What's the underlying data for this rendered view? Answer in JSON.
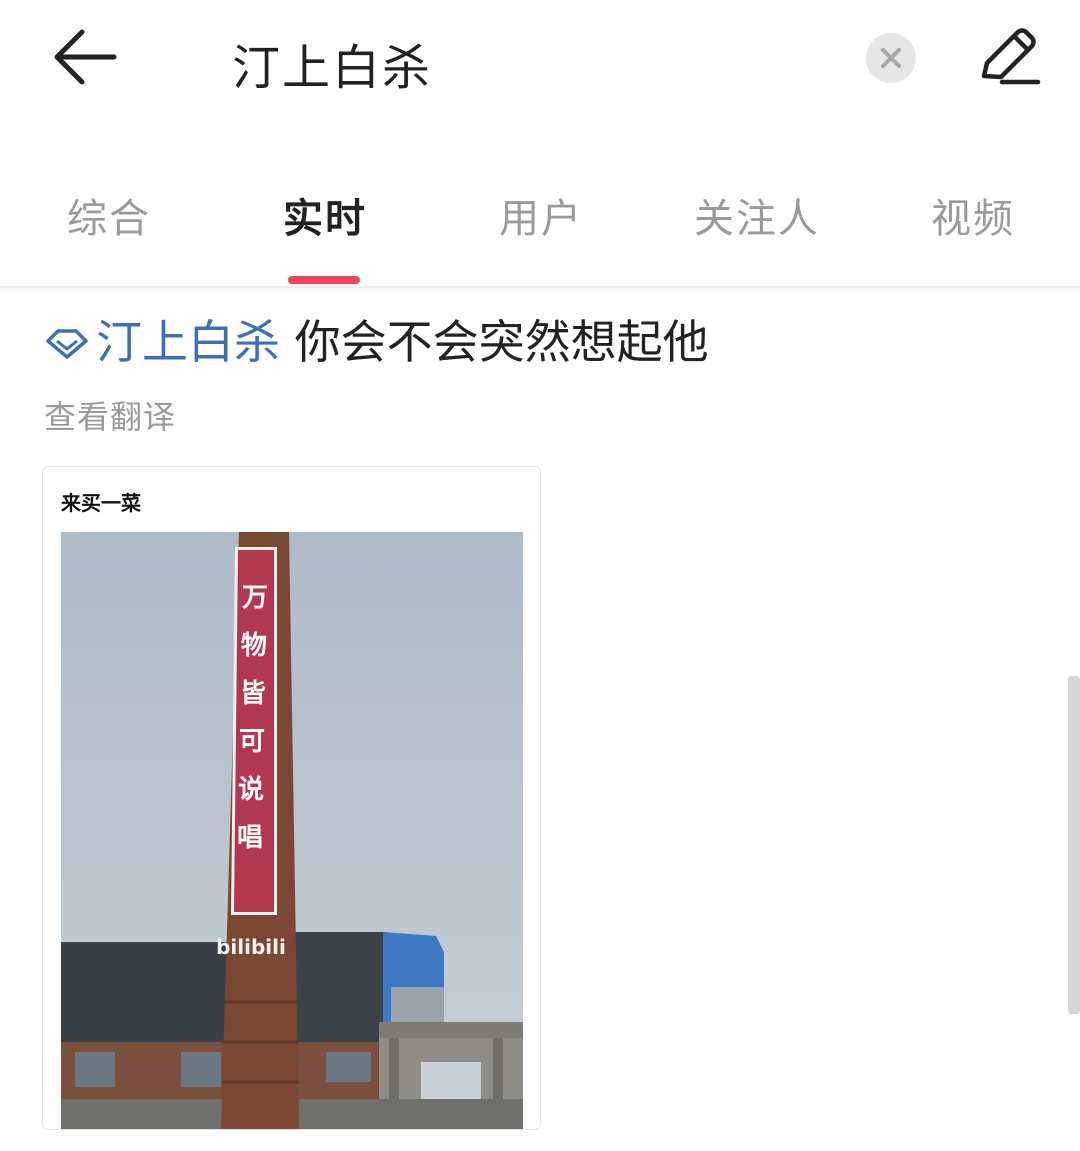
{
  "header": {
    "search_query": "汀上白杀",
    "back_icon": "arrow-left-icon",
    "clear_icon": "close-circle-icon",
    "edit_icon": "pencil-icon"
  },
  "tabs": [
    {
      "label": "综合",
      "active": false
    },
    {
      "label": "实时",
      "active": true
    },
    {
      "label": "用户",
      "active": false
    },
    {
      "label": "关注人",
      "active": false
    },
    {
      "label": "视频",
      "active": false
    }
  ],
  "post": {
    "topic_icon": "diamond-topic-icon",
    "topic": "汀上白杀",
    "text": " 你会不会突然想起他",
    "translate_label": "查看翻译",
    "image_card": {
      "caption": "来买一菜",
      "chimney_text": [
        "万",
        "物",
        "皆",
        "可",
        "说",
        "唱"
      ],
      "logo_text": "bilibili"
    }
  },
  "colors": {
    "accent": "#f0445c",
    "topic_blue": "#3c6fb6",
    "muted_text": "#9a9a9a"
  }
}
